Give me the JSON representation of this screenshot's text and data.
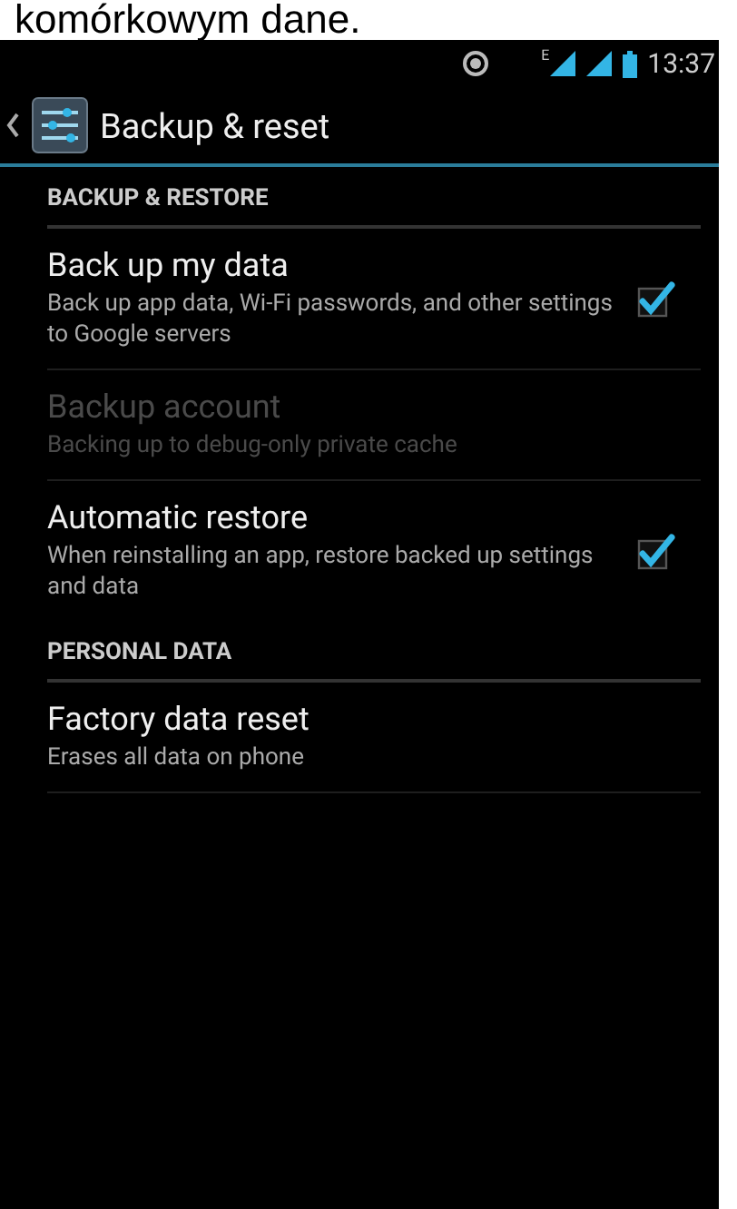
{
  "page_caption": "komórkowym dane.",
  "status_bar": {
    "network_type": "E",
    "time": "13:37"
  },
  "action_bar": {
    "title": "Backup & reset"
  },
  "sections": [
    {
      "header": "BACKUP & RESTORE",
      "items": [
        {
          "kind": "checkbox",
          "title": "Back up my data",
          "summary": "Back up app data, Wi-Fi passwords, and other settings to Google servers",
          "checked": true,
          "disabled": false
        },
        {
          "kind": "plain",
          "title": "Backup account",
          "summary": "Backing up to debug-only private cache",
          "disabled": true
        },
        {
          "kind": "checkbox",
          "title": "Automatic restore",
          "summary": "When reinstalling an app, restore backed up settings and data",
          "checked": true,
          "disabled": false
        }
      ]
    },
    {
      "header": "PERSONAL DATA",
      "items": [
        {
          "kind": "plain",
          "title": "Factory data reset",
          "summary": "Erases all data on phone",
          "disabled": false
        }
      ]
    }
  ]
}
